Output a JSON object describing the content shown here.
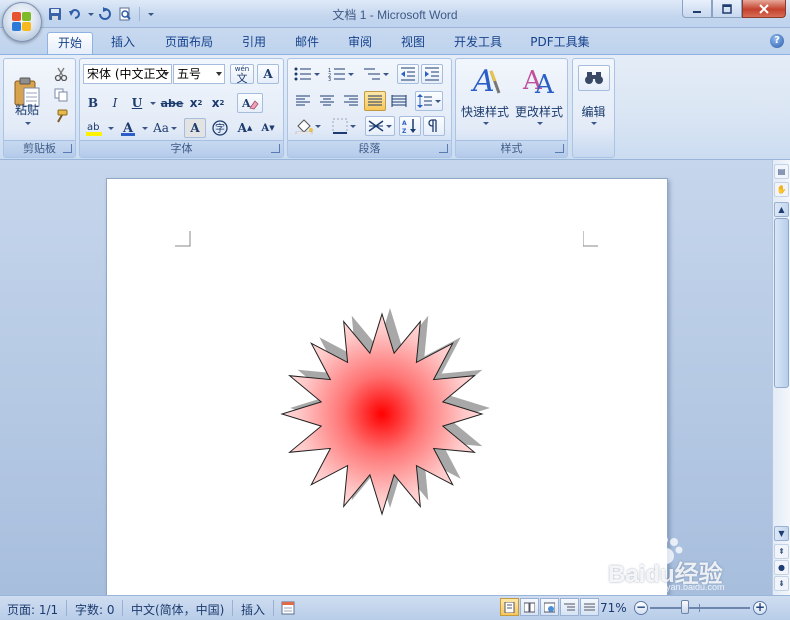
{
  "window": {
    "title": "文档 1 - Microsoft Word",
    "minimize": "minimize",
    "maximize": "maximize",
    "close": "close"
  },
  "tabs": [
    "开始",
    "插入",
    "页面布局",
    "引用",
    "邮件",
    "审阅",
    "视图",
    "开发工具",
    "PDF工具集"
  ],
  "ribbon": {
    "clipboard": {
      "label": "剪贴板",
      "paste": "粘贴"
    },
    "font": {
      "label": "字体",
      "font_name": "宋体 (中文正文",
      "font_size": "五号",
      "bold": "B",
      "italic": "I",
      "underline": "U",
      "strike": "abe",
      "subscript": "x",
      "superscript": "x",
      "case": "Aa",
      "grow": "A",
      "shrink": "A",
      "char_border": "A",
      "phonetic": "wén",
      "phonetic_char": "文"
    },
    "paragraph": {
      "label": "段落"
    },
    "styles": {
      "label": "样式",
      "quick_styles": "快速样式",
      "change_styles": "更改样式"
    },
    "editing": {
      "label": "编辑"
    }
  },
  "statusbar": {
    "page": "页面: 1/1",
    "words": "字数: 0",
    "language": "中文(简体，中国)",
    "mode": "插入",
    "zoom": "71%",
    "zoom_out": "−",
    "zoom_in": "+"
  },
  "watermark": "Baidu经验",
  "watermark_sub": "jingyan.baidu.com",
  "colors": {
    "accent": "#15428b",
    "shape_fill_center": "#ff0000",
    "shape_fill_edge": "#ffd6d6"
  }
}
